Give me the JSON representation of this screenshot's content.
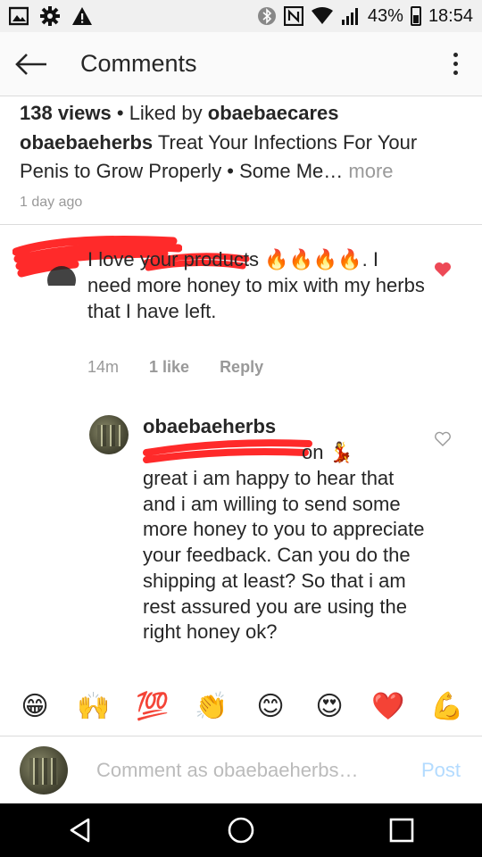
{
  "status_bar": {
    "battery_percent": "43%",
    "time": "18:54",
    "icons": [
      "image-icon",
      "settings-icon",
      "warning-icon",
      "bluetooth-icon",
      "nfc-icon",
      "wifi-icon",
      "signal-icon",
      "battery-icon"
    ]
  },
  "app_bar": {
    "title": "Comments"
  },
  "post": {
    "views": "138 views",
    "separator": " • ",
    "liked_by_prefix": "Liked by ",
    "liked_by_user": "obaebaecares",
    "caption_user": "obaebaeherbs",
    "caption_text": " Treat Your Infections For Your Penis to Grow Properly • Some Me…",
    "more": " more",
    "time": "1 day ago"
  },
  "comments": [
    {
      "text": "I love your products 🔥🔥🔥🔥. I need more honey to mix with my herbs that I have left.",
      "time": "14m",
      "likes": "1 like",
      "reply": "Reply"
    },
    {
      "user": "obaebaeherbs",
      "text_visible_partial": "on 💃",
      "text": "great i am happy to hear that and i am willing to send some more honey to you to appreciate your feedback. Can you do the shipping at least? So that i am rest assured you are using the right honey ok?"
    }
  ],
  "emoji_bar": [
    "😁",
    "🙌",
    "💯",
    "👏",
    "😊",
    "😍",
    "❤️",
    "💪"
  ],
  "composer": {
    "placeholder": "Comment as obaebaeherbs…",
    "post_label": "Post"
  },
  "colors": {
    "heart": "#ed4956",
    "post_disabled": "#b3dbff",
    "muted": "#999999",
    "redaction": "#ff2a2a"
  }
}
